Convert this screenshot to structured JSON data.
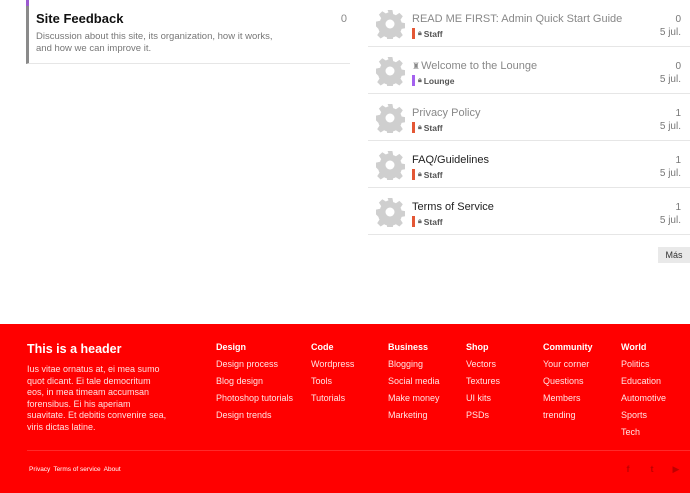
{
  "category": {
    "title": "Site Feedback",
    "count": "0",
    "description": "Discussion about this site, its organization, how it works, and how we can improve it.",
    "color": "#9b59d0"
  },
  "topics": [
    {
      "title": "READ ME FIRST: Admin Quick Start Guide",
      "prefix": "",
      "badge": "Staff",
      "badge_color": "#e45735",
      "replies": "0",
      "date": "5 jul.",
      "muted": true
    },
    {
      "title": "Welcome to the Lounge",
      "prefix": "♜",
      "badge": "Lounge",
      "badge_color": "#a461ef",
      "replies": "0",
      "date": "5 jul.",
      "muted": true
    },
    {
      "title": "Privacy Policy",
      "prefix": "",
      "badge": "Staff",
      "badge_color": "#e45735",
      "replies": "1",
      "date": "5 jul.",
      "muted": true
    },
    {
      "title": "FAQ/Guidelines",
      "prefix": "",
      "badge": "Staff",
      "badge_color": "#e45735",
      "replies": "1",
      "date": "5 jul.",
      "muted": false
    },
    {
      "title": "Terms of Service",
      "prefix": "",
      "badge": "Staff",
      "badge_color": "#e45735",
      "replies": "1",
      "date": "5 jul.",
      "muted": false
    }
  ],
  "more_label": "Más",
  "footer": {
    "header": "This is a header",
    "text": "Ius vitae ornatus at, ei mea sumo quot dicant. Ei tale democritum eos, in mea timeam accumsan forensibus. Ei his aperiam suavitate. Et debitis convenire sea, viris dictas latine.",
    "columns": [
      {
        "heading": "Design",
        "links": [
          "Design process",
          "Blog design",
          "Photoshop tutorials",
          "Design trends"
        ]
      },
      {
        "heading": "Code",
        "links": [
          "Wordpress",
          "Tools",
          "Tutorials"
        ]
      },
      {
        "heading": "Business",
        "links": [
          "Blogging",
          "Social media",
          "Make money",
          "Marketing"
        ]
      },
      {
        "heading": "Shop",
        "links": [
          "Vectors",
          "Textures",
          "UI kits",
          "PSDs"
        ]
      },
      {
        "heading": "Community",
        "links": [
          "Your corner",
          "Questions",
          "Members",
          "trending"
        ]
      },
      {
        "heading": "World",
        "links": [
          "Politics",
          "Education",
          "Automotive",
          "Sports",
          "Tech"
        ]
      }
    ],
    "bottom_links": [
      "Privacy",
      "Terms of service",
      "About"
    ],
    "social": [
      {
        "name": "facebook-icon",
        "glyph": "f"
      },
      {
        "name": "twitter-icon",
        "glyph": "t"
      },
      {
        "name": "youtube-icon",
        "glyph": "▶"
      }
    ],
    "bg_color": "#ff0000"
  }
}
